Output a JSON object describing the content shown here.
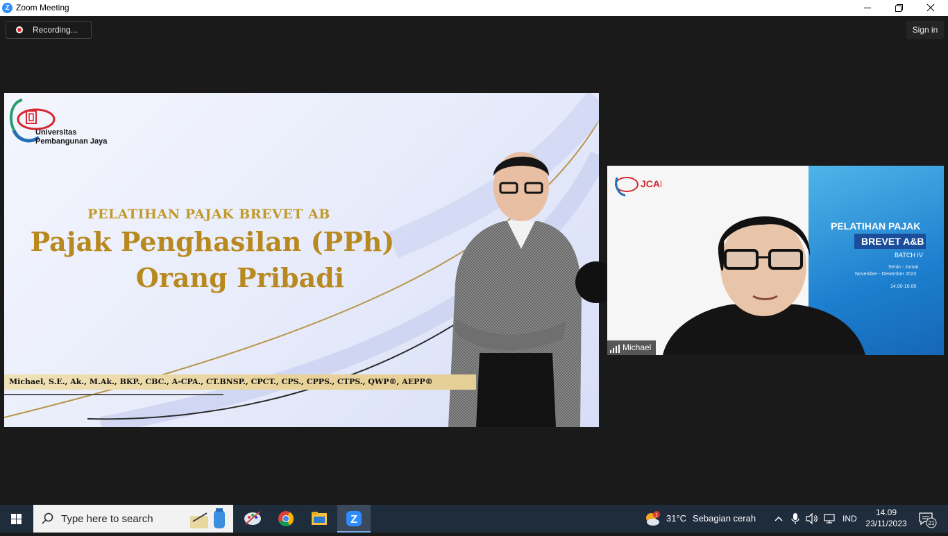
{
  "window": {
    "title": "Zoom Meeting",
    "icon": "zoom-icon",
    "controls": [
      "minimize-icon",
      "restore-icon",
      "close-icon"
    ]
  },
  "zoom": {
    "recording_label": "Recording...",
    "sign_in_label": "Sign in"
  },
  "slide": {
    "university_line1": "Universitas",
    "university_line2": "Pembangunan Jaya",
    "subtitle": "PELATIHAN PAJAK BREVET AB",
    "heading_line1": "Pajak Penghasilan (PPh)",
    "heading_line2": "Orang Pribadi",
    "credentials": "Michael, S.E., Ak., M.Ak., BKP., CBC., A-CPA., CT.BNSP., CPCT., CPS., CPPS., CTPS., QWP®, AEPP®"
  },
  "webcam": {
    "participant_name": "Michael",
    "background_title1": "PELATIHAN PAJAK",
    "background_title2": "BREVET A&B",
    "background_batch": "BATCH IV",
    "background_days": "Senin - Jumat",
    "background_months": "November - Desember 2023",
    "background_time": "14.00-16.00"
  },
  "taskbar": {
    "search_placeholder": "Type here to search",
    "apps": [
      "explorer-widget-icon",
      "paint-icon",
      "chrome-icon",
      "file-explorer-icon",
      "zoom-icon"
    ],
    "weather_temp": "31°C",
    "weather_desc": "Sebagian cerah",
    "weather_badge": "1",
    "language": "IND",
    "time": "14.09",
    "date": "23/11/2023",
    "notification_count": "21"
  },
  "colors": {
    "zoom_blue": "#2d8cff",
    "slide_gold": "#b8891f",
    "taskbar": "#1e2c3b"
  }
}
